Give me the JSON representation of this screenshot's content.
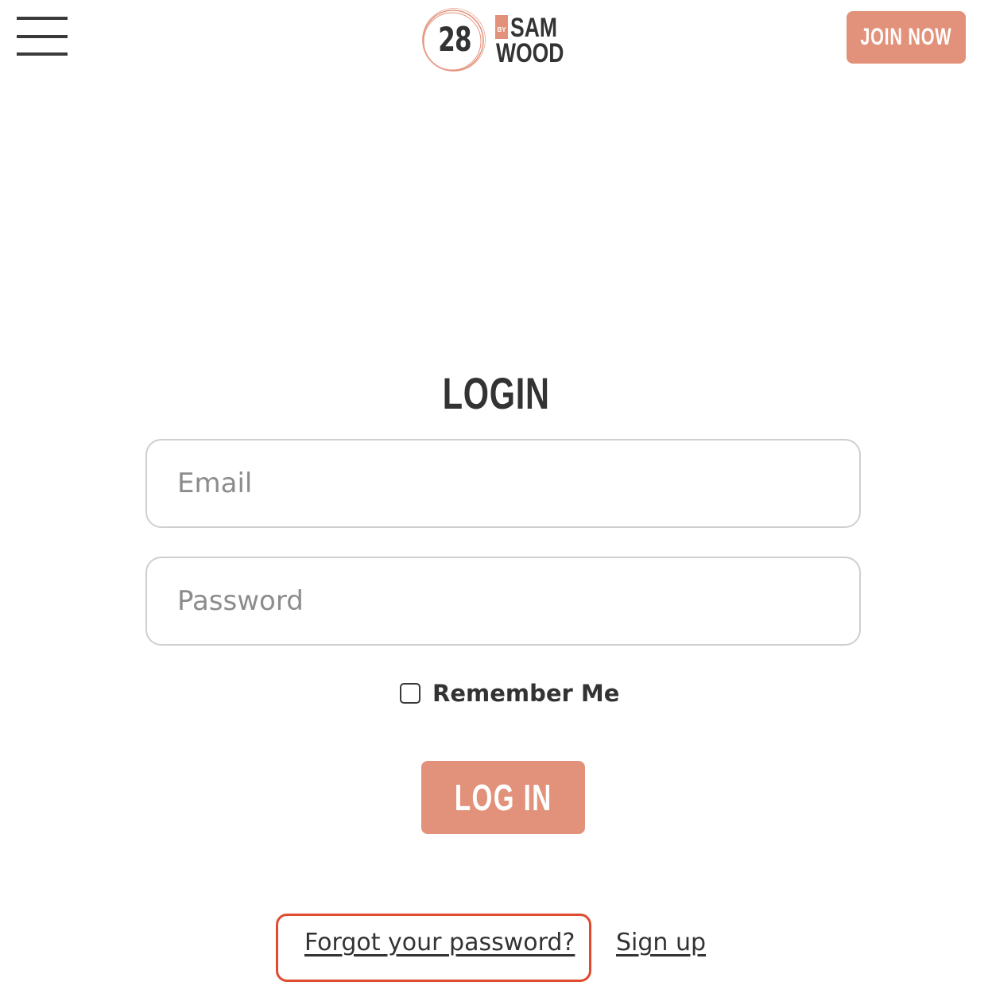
{
  "header": {
    "logo": {
      "number": "28",
      "by": "BY",
      "sam": "SAM",
      "wood": "WOOD"
    },
    "join_label": "JOIN NOW"
  },
  "login": {
    "title": "LOGIN",
    "email_placeholder": "Email",
    "password_placeholder": "Password",
    "remember_label": "Remember Me",
    "submit_label": "LOG IN",
    "forgot_label": "Forgot your password?",
    "signup_label": "Sign up"
  },
  "colors": {
    "accent": "#e2927a",
    "highlight": "#e04a2f",
    "text": "#333333",
    "border": "#cfcfcf"
  },
  "icons": [
    "hamburger-menu-icon",
    "logo-circle-icon"
  ]
}
